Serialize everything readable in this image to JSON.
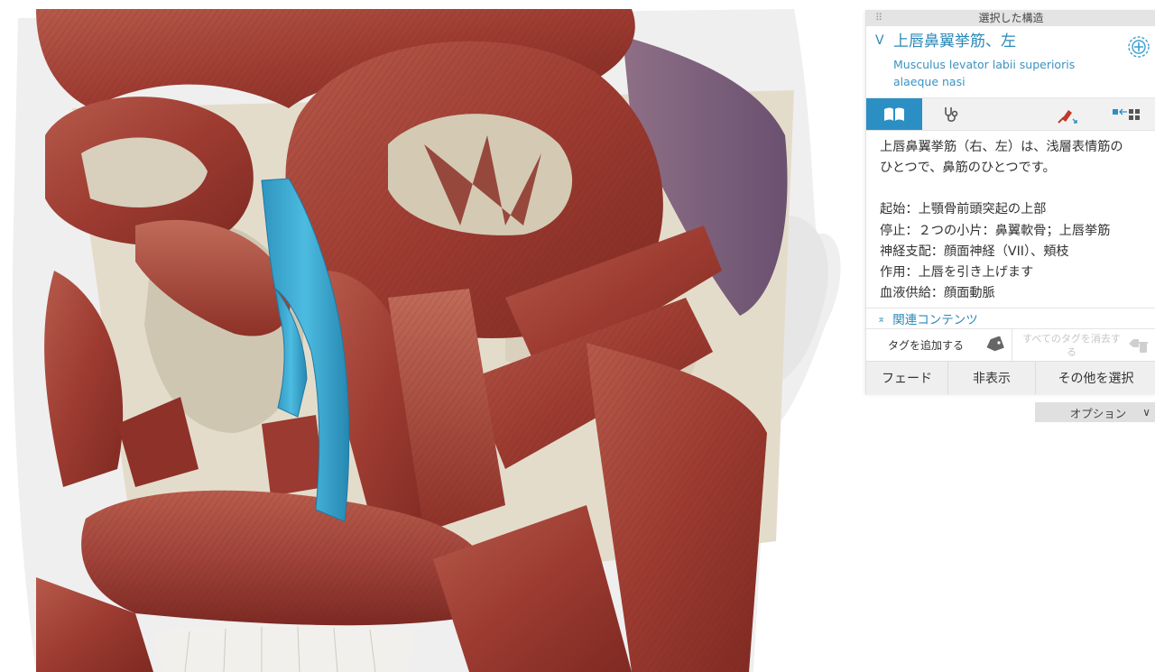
{
  "panel": {
    "header_title": "選択した構造",
    "structure_name": "上唇鼻翼挙筋、左",
    "latin_name": "Musculus levator labii superioris alaeque nasi",
    "description_lines": [
      "上唇鼻翼挙筋（右、左）は、浅層表情筋の",
      "ひとつで、鼻筋のひとつです。"
    ],
    "details": [
      "起始：上顎骨前頭突起の上部",
      "停止：２つの小片：鼻翼軟骨；上唇挙筋",
      "神経支配：顔面神経（VII）、頬枝",
      "作用：上唇を引き上げます",
      "血液供給：顔面動脈"
    ],
    "related_label": "関連コンテンツ",
    "add_tag_label": "タグを追加する",
    "clear_tags_label": "すべてのタグを消去する",
    "actions": {
      "fade": "フェード",
      "hide": "非表示",
      "select_others": "その他を選択"
    },
    "options_label": "オプション"
  },
  "tabs": [
    {
      "icon": "book-icon",
      "active": true
    },
    {
      "icon": "stethoscope-icon",
      "active": false
    },
    {
      "icon": "pin-icon",
      "active": false
    },
    {
      "icon": "isolate-icon",
      "active": false
    }
  ],
  "colors": {
    "accent": "#2b8fc3",
    "link": "#2a89b8",
    "muscle": "#a8443a",
    "selected_muscle": "#39a7cf",
    "bone": "#e4dccb"
  }
}
